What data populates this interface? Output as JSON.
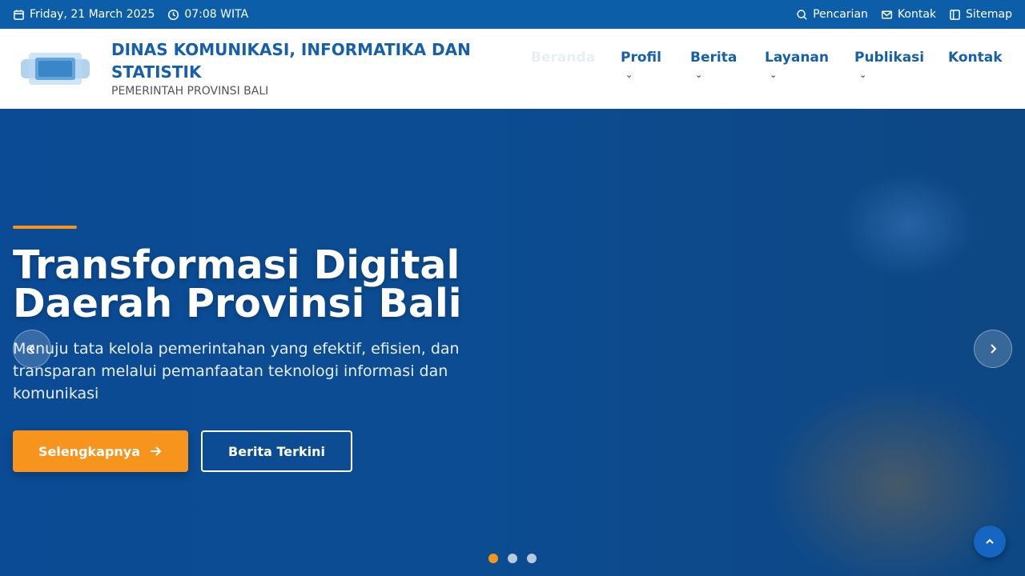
{
  "topbar": {
    "date": "Friday, 21 March 2025",
    "time": "07:08 WITA",
    "links": [
      "Pencarian",
      "Kontak",
      "Sitemap"
    ]
  },
  "header": {
    "title": "DINAS KOMUNIKASI, INFORMATIKA DAN STATISTIK",
    "subtitle": "PEMERINTAH PROVINSI BALI"
  },
  "nav": {
    "items": [
      {
        "label": "Beranda",
        "has_dropdown": false
      },
      {
        "label": "Profil",
        "has_dropdown": true
      },
      {
        "label": "Berita",
        "has_dropdown": true
      },
      {
        "label": "Layanan",
        "has_dropdown": true
      },
      {
        "label": "Publikasi",
        "has_dropdown": true
      },
      {
        "label": "Kontak",
        "has_dropdown": false
      }
    ],
    "dropdown_glyph": "⌄"
  },
  "hero": {
    "title_line1": "Transformasi Digital",
    "title_line2": "Daerah Provinsi Bali",
    "description": "Menuju tata kelola pemerintahan yang efektif, efisien, dan transparan melalui pemanfaatan teknologi informasi dan komunikasi",
    "primary_button": "Selengkapnya",
    "secondary_button": "Berita Terkini",
    "slides": 3,
    "active_slide": 1
  },
  "colors": {
    "primary": "#0d5ea8",
    "accent": "#f7941d",
    "hero_bg": "#0b4b95"
  },
  "icons": {
    "date": "calendar-icon",
    "time": "clock-icon",
    "search": "search-icon",
    "contact": "mail-icon",
    "sitemap": "sitemap-icon",
    "prev": "chevron-left-icon",
    "next": "chevron-right-icon",
    "button_arrow": "arrow-right-icon",
    "back_to_top": "chevron-up-icon"
  }
}
